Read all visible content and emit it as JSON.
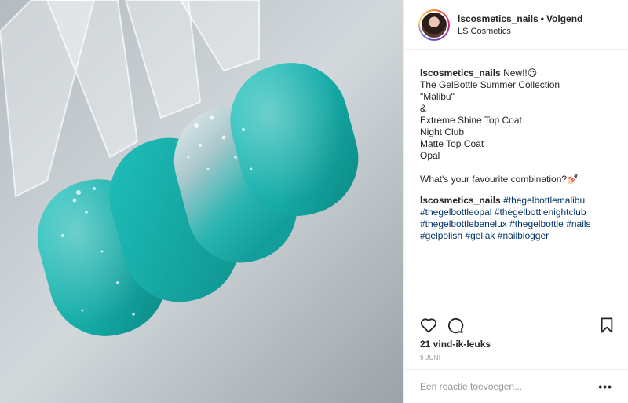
{
  "header": {
    "username": "lscosmetics_nails",
    "separator": "•",
    "follow_label": "Volgend",
    "location": "LS Cosmetics"
  },
  "caption": {
    "username": "lscosmetics_nails",
    "first_line": "New!!😍",
    "lines": [
      "The GelBottle Summer Collection",
      "\"Malibu\"",
      "&",
      "Extreme Shine Top Coat",
      "Night Club",
      "Matte Top Coat",
      "Opal",
      "",
      "What's your favourite combination?💅🏻"
    ]
  },
  "hashtag_comment": {
    "username": "lscosmetics_nails",
    "tags": [
      "#thegelbottlemalibu",
      "#thegelbottleopal",
      "#thegelbottlenightclub",
      "#thegelbottlebenelux",
      "#thegelbottle",
      "#nails",
      "#gelpolish",
      "#gellak",
      "#nailblogger"
    ]
  },
  "actions": {
    "like_icon": "heart-icon",
    "comment_icon": "comment-icon",
    "save_icon": "bookmark-icon"
  },
  "likes_text": "21 vind-ik-leuks",
  "date_text": "9 JUNI",
  "comment_input": {
    "placeholder": "Een reactie toevoegen...",
    "value": ""
  },
  "more_label": "•••",
  "colors": {
    "link": "#003569",
    "text": "#262626",
    "muted": "#999999",
    "divider": "#efefef",
    "nail_teal": "#18b3b0"
  }
}
